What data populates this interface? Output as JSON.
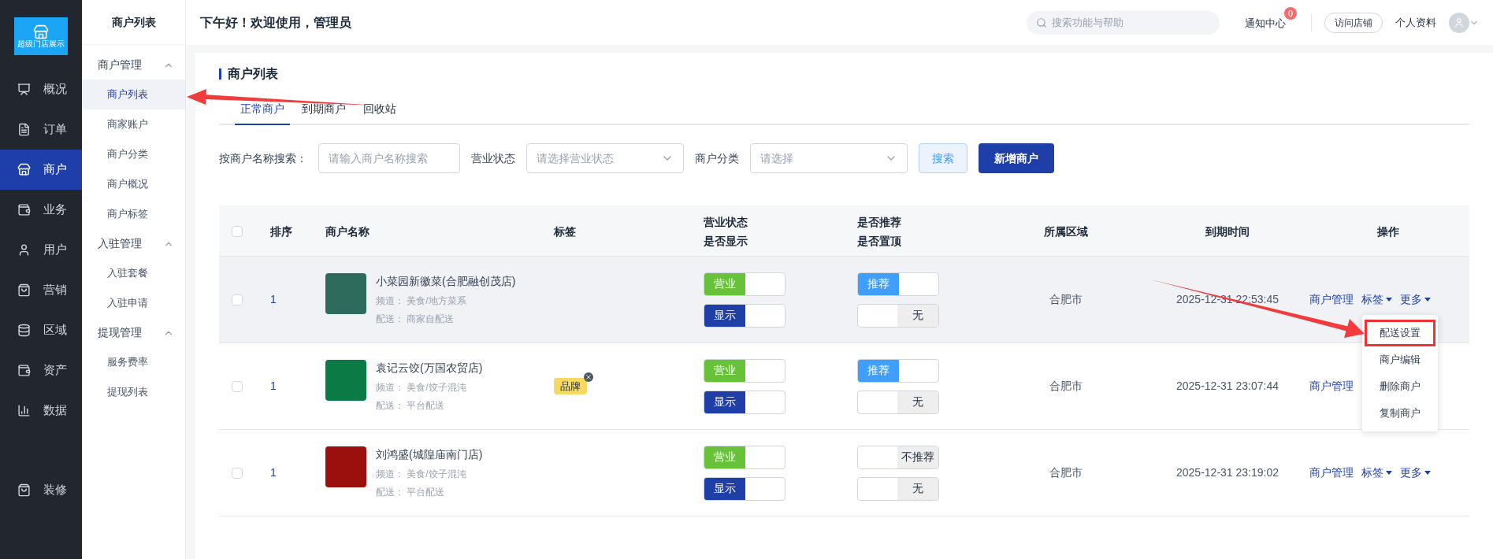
{
  "brand": {
    "logo_text": "超级门店展示"
  },
  "nav": [
    {
      "label": "概况",
      "selected": false
    },
    {
      "label": "订单",
      "selected": false
    },
    {
      "label": "商户",
      "selected": true
    },
    {
      "label": "业务",
      "selected": false
    },
    {
      "label": "用户",
      "selected": false
    },
    {
      "label": "营销",
      "selected": false
    },
    {
      "label": "区域",
      "selected": false
    },
    {
      "label": "资产",
      "selected": false
    },
    {
      "label": "数据",
      "selected": false
    },
    {
      "label": "装修",
      "selected": false
    }
  ],
  "submenu": {
    "title": "商户列表",
    "groups": [
      {
        "label": "商户管理",
        "expanded": true,
        "children": [
          {
            "label": "商户列表",
            "selected": true
          },
          {
            "label": "商家账户",
            "selected": false
          },
          {
            "label": "商户分类",
            "selected": false
          },
          {
            "label": "商户概况",
            "selected": false
          },
          {
            "label": "商户标签",
            "selected": false
          }
        ]
      },
      {
        "label": "入驻管理",
        "expanded": true,
        "children": [
          {
            "label": "入驻套餐",
            "selected": false
          },
          {
            "label": "入驻申请",
            "selected": false
          }
        ]
      },
      {
        "label": "提现管理",
        "expanded": true,
        "children": [
          {
            "label": "服务费率",
            "selected": false
          },
          {
            "label": "提现列表",
            "selected": false
          }
        ]
      }
    ]
  },
  "header": {
    "greeting": "下午好！欢迎使用，管理员",
    "search": {
      "placeholder": "搜索功能与帮助"
    },
    "notifications": {
      "label": "通知中心",
      "badge": "0"
    },
    "visit_button": "访问店铺",
    "profile": "个人资料"
  },
  "page": {
    "title": "商户列表",
    "tabs": [
      {
        "label": "正常商户",
        "selected": true
      },
      {
        "label": "到期商户",
        "selected": false
      },
      {
        "label": "回收站",
        "selected": false
      }
    ],
    "filters": [
      {
        "kind": "input",
        "label": "按商户名称搜索：",
        "placeholder": "请输入商户名称搜索"
      },
      {
        "kind": "select",
        "label": "营业状态",
        "placeholder": "请选择营业状态"
      },
      {
        "kind": "select",
        "label": "商户分类",
        "placeholder": "请选择"
      }
    ],
    "buttons": [
      {
        "kind": "secondary",
        "label": "搜索"
      },
      {
        "kind": "primary",
        "label": "新增商户"
      }
    ]
  },
  "table": {
    "header_checkbox": {
      "checked": false
    },
    "columns": [
      {
        "lines": [
          "排序"
        ]
      },
      {
        "lines": [
          "商户名称"
        ]
      },
      {
        "lines": [
          "标签"
        ]
      },
      {
        "lines": [
          "营业状态",
          "是否显示"
        ]
      },
      {
        "lines": [
          "是否推荐",
          "是否置顶"
        ]
      },
      {
        "lines": [
          "所属区域"
        ]
      },
      {
        "lines": [
          "到期时间"
        ]
      },
      {
        "lines": [
          "操作"
        ]
      }
    ],
    "rows": [
      {
        "checked": false,
        "hovered": true,
        "order": "1",
        "logo": {
          "color": "#2f6b5c"
        },
        "name": "小菜园新徽菜(合肥融创茂店)",
        "channel": "频道： 美食/地方菜系",
        "delivery": "配送： 商家自配送",
        "tags": [],
        "status_toggles": [
          {
            "label": "营业",
            "on": true
          },
          {
            "label": "显示",
            "on": true
          }
        ],
        "promo_toggles": [
          {
            "label": "推荐",
            "on": true
          },
          {
            "label": "无",
            "on": false
          }
        ],
        "region": "合肥市",
        "expires": "2025-12-31 22:53:45",
        "actions": [
          {
            "kind": "link",
            "label": "商户管理"
          },
          {
            "kind": "dropdown",
            "label": "标签"
          },
          {
            "kind": "dropdown",
            "label": "更多",
            "menu": {
              "items": [
                {
                  "label": "配送设置",
                  "highlighted": true
                },
                {
                  "label": "商户编辑",
                  "highlighted": false
                },
                {
                  "label": "删除商户",
                  "highlighted": false
                },
                {
                  "label": "复制商户",
                  "highlighted": false
                }
              ]
            }
          }
        ]
      },
      {
        "checked": false,
        "hovered": false,
        "order": "1",
        "logo": {
          "color": "#0b7a45"
        },
        "name": "袁记云饺(万国农贸店)",
        "channel": "频道： 美食/饺子混沌",
        "delivery": "配送： 平台配送",
        "tags": [
          {
            "label": "品牌"
          }
        ],
        "status_toggles": [
          {
            "label": "营业",
            "on": true
          },
          {
            "label": "显示",
            "on": true
          }
        ],
        "promo_toggles": [
          {
            "label": "推荐",
            "on": true
          },
          {
            "label": "无",
            "on": false
          }
        ],
        "region": "合肥市",
        "expires": "2025-12-31 23:07:44",
        "actions": [
          {
            "kind": "link",
            "label": "商户管理"
          }
        ]
      },
      {
        "checked": false,
        "hovered": false,
        "order": "1",
        "logo": {
          "color": "#9b0f0c"
        },
        "name": "刘鸿盛(城隍庙南门店)",
        "channel": "频道： 美食/饺子混沌",
        "delivery": "配送： 平台配送",
        "tags": [],
        "status_toggles": [
          {
            "label": "营业",
            "on": true
          },
          {
            "label": "显示",
            "on": true
          }
        ],
        "promo_toggles": [
          {
            "label": "不推荐",
            "on": false
          },
          {
            "label": "无",
            "on": false
          }
        ],
        "region": "合肥市",
        "expires": "2025-12-31 23:19:02",
        "actions": [
          {
            "kind": "link",
            "label": "商户管理"
          },
          {
            "kind": "dropdown",
            "label": "标签"
          },
          {
            "kind": "dropdown",
            "label": "更多"
          }
        ]
      }
    ]
  },
  "annotations": [
    {
      "kind": "arrow"
    },
    {
      "kind": "arrow"
    }
  ]
}
